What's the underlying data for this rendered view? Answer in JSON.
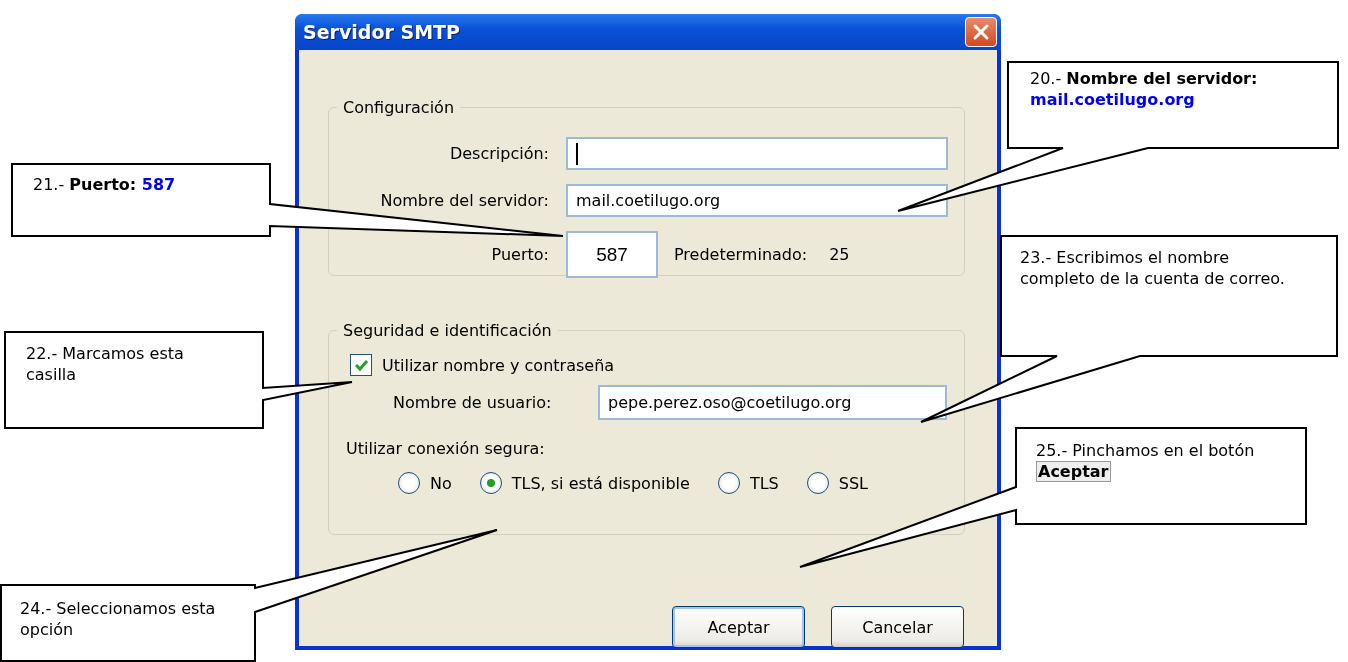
{
  "window": {
    "title": "Servidor SMTP"
  },
  "config_group": {
    "legend": "Configuración",
    "fields": [
      {
        "label": "Descripción:",
        "focused": true
      },
      {
        "label": "Nombre del servidor:",
        "value": "mail.coetilugo.org",
        "focused": false
      }
    ],
    "port": {
      "label": "Puerto:",
      "value": "587"
    },
    "default_port": {
      "label": "Predeterminado:",
      "value": "25"
    }
  },
  "security_group": {
    "legend": "Seguridad e identificación",
    "auth_checkbox": {
      "label": "Utilizar nombre y contraseña",
      "checked": true
    },
    "username": {
      "label": "Nombre de usuario:",
      "value": "pepe.perez.oso@coetilugo.org"
    },
    "secure_label": "Utilizar conexión segura:",
    "options": [
      {
        "label": "No",
        "selected": false
      },
      {
        "label": "TLS, si está disponible",
        "selected": true
      },
      {
        "label": "TLS",
        "selected": false
      },
      {
        "label": "SSL",
        "selected": false
      }
    ]
  },
  "buttons": [
    {
      "label": "Aceptar",
      "default": true
    },
    {
      "label": "Cancelar",
      "default": false
    }
  ],
  "callouts": [
    {
      "parts": [
        {
          "kind": "plain",
          "text": "20.- "
        },
        {
          "kind": "bold",
          "text": "Nombre del servidor: "
        },
        {
          "kind": "blue",
          "text": "mail.coetilugo.org"
        }
      ]
    },
    {
      "parts": [
        {
          "kind": "plain",
          "text": "21.- "
        },
        {
          "kind": "bold",
          "text": "Puerto: "
        },
        {
          "kind": "blue",
          "text": "587"
        }
      ]
    },
    {
      "parts": [
        {
          "kind": "plain",
          "text": "22.- Marcamos esta casilla"
        }
      ]
    },
    {
      "parts": [
        {
          "kind": "plain",
          "text": "23.- Escribimos el nombre completo de la cuenta de correo."
        }
      ]
    },
    {
      "parts": [
        {
          "kind": "plain",
          "text": "24.- Seleccionamos esta opción"
        }
      ]
    },
    {
      "parts": [
        {
          "kind": "plain",
          "text": "25.- Pinchamos en el botón "
        },
        {
          "kind": "button",
          "text": "Aceptar"
        }
      ]
    }
  ]
}
